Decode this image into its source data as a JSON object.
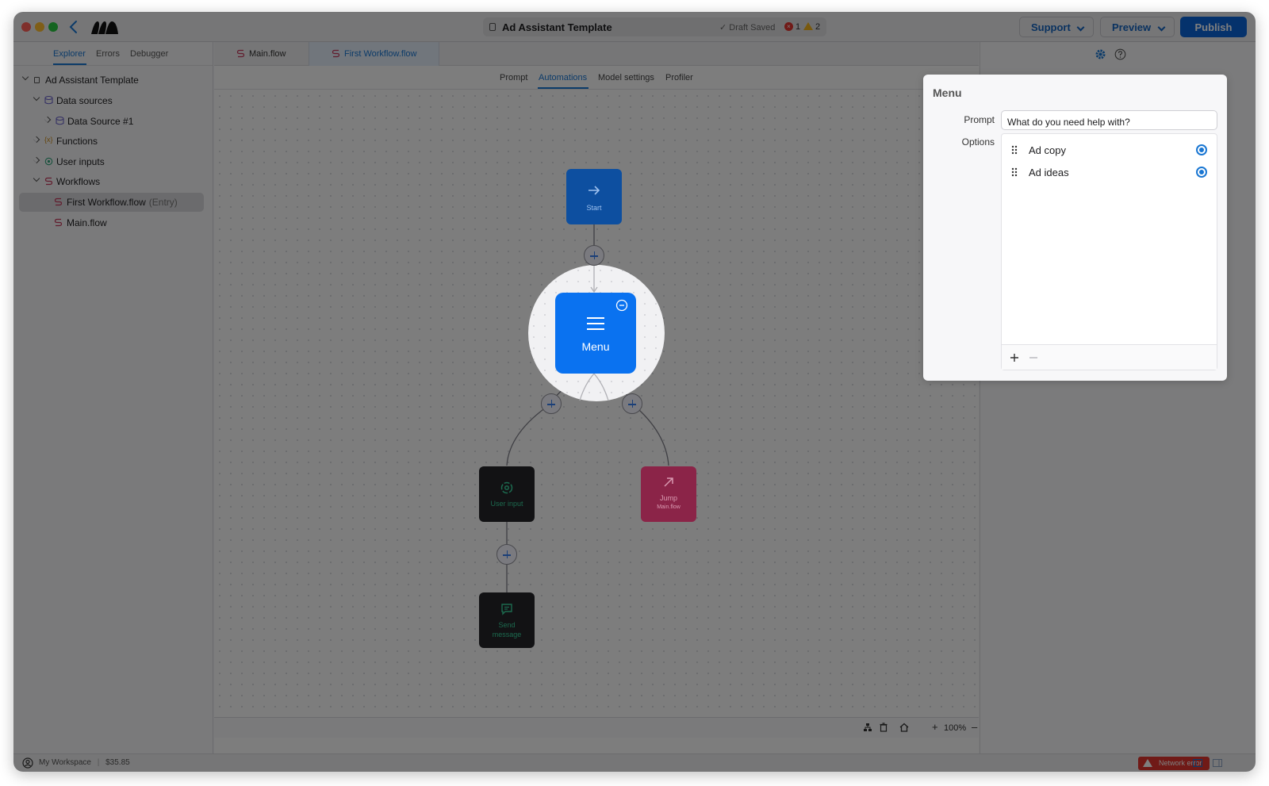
{
  "window": {
    "doc_title": "Ad Assistant Template",
    "draft_status": "✓ Draft Saved",
    "error_count": "1",
    "warning_count": "2"
  },
  "toolbar": {
    "support_label": "Support",
    "preview_label": "Preview",
    "publish_label": "Publish"
  },
  "sidebar": {
    "tabs": [
      "Explorer",
      "Errors",
      "Debugger"
    ],
    "tree": {
      "root": "Ad Assistant Template",
      "data_sources": "Data sources",
      "data_source_1": "Data Source #1",
      "functions": "Functions",
      "user_inputs": "User inputs",
      "workflows": "Workflows",
      "first_workflow": "First Workflow.flow",
      "entry_tag": "(Entry)",
      "main_flow": "Main.flow"
    }
  },
  "file_tabs": [
    "Main.flow",
    "First Workflow.flow"
  ],
  "sub_tabs": [
    "Prompt",
    "Automations",
    "Model settings",
    "Profiler"
  ],
  "flow": {
    "start_label": "Start",
    "menu_label": "Menu",
    "user_input_label": "User input",
    "jump_label": "Jump",
    "jump_target": "Main.flow",
    "send_message_line1": "Send",
    "send_message_line2": "message"
  },
  "canvas_bar": {
    "zoom": "100%"
  },
  "popover": {
    "title": "Menu",
    "prompt_label": "Prompt",
    "prompt_value": "What do you need help with?",
    "options_label": "Options",
    "options": [
      "Ad copy",
      "Ad ideas"
    ]
  },
  "statusbar": {
    "workspace": "My Workspace",
    "balance": "$35.85",
    "network_error": "Network error"
  },
  "colors": {
    "accent": "#1976d2",
    "publish": "#0a64d8",
    "menu_node": "#0a72f0",
    "start_node": "#0d4fa0",
    "jump_node": "#8b2448",
    "dark_node": "#121214",
    "error": "#e0342e"
  }
}
